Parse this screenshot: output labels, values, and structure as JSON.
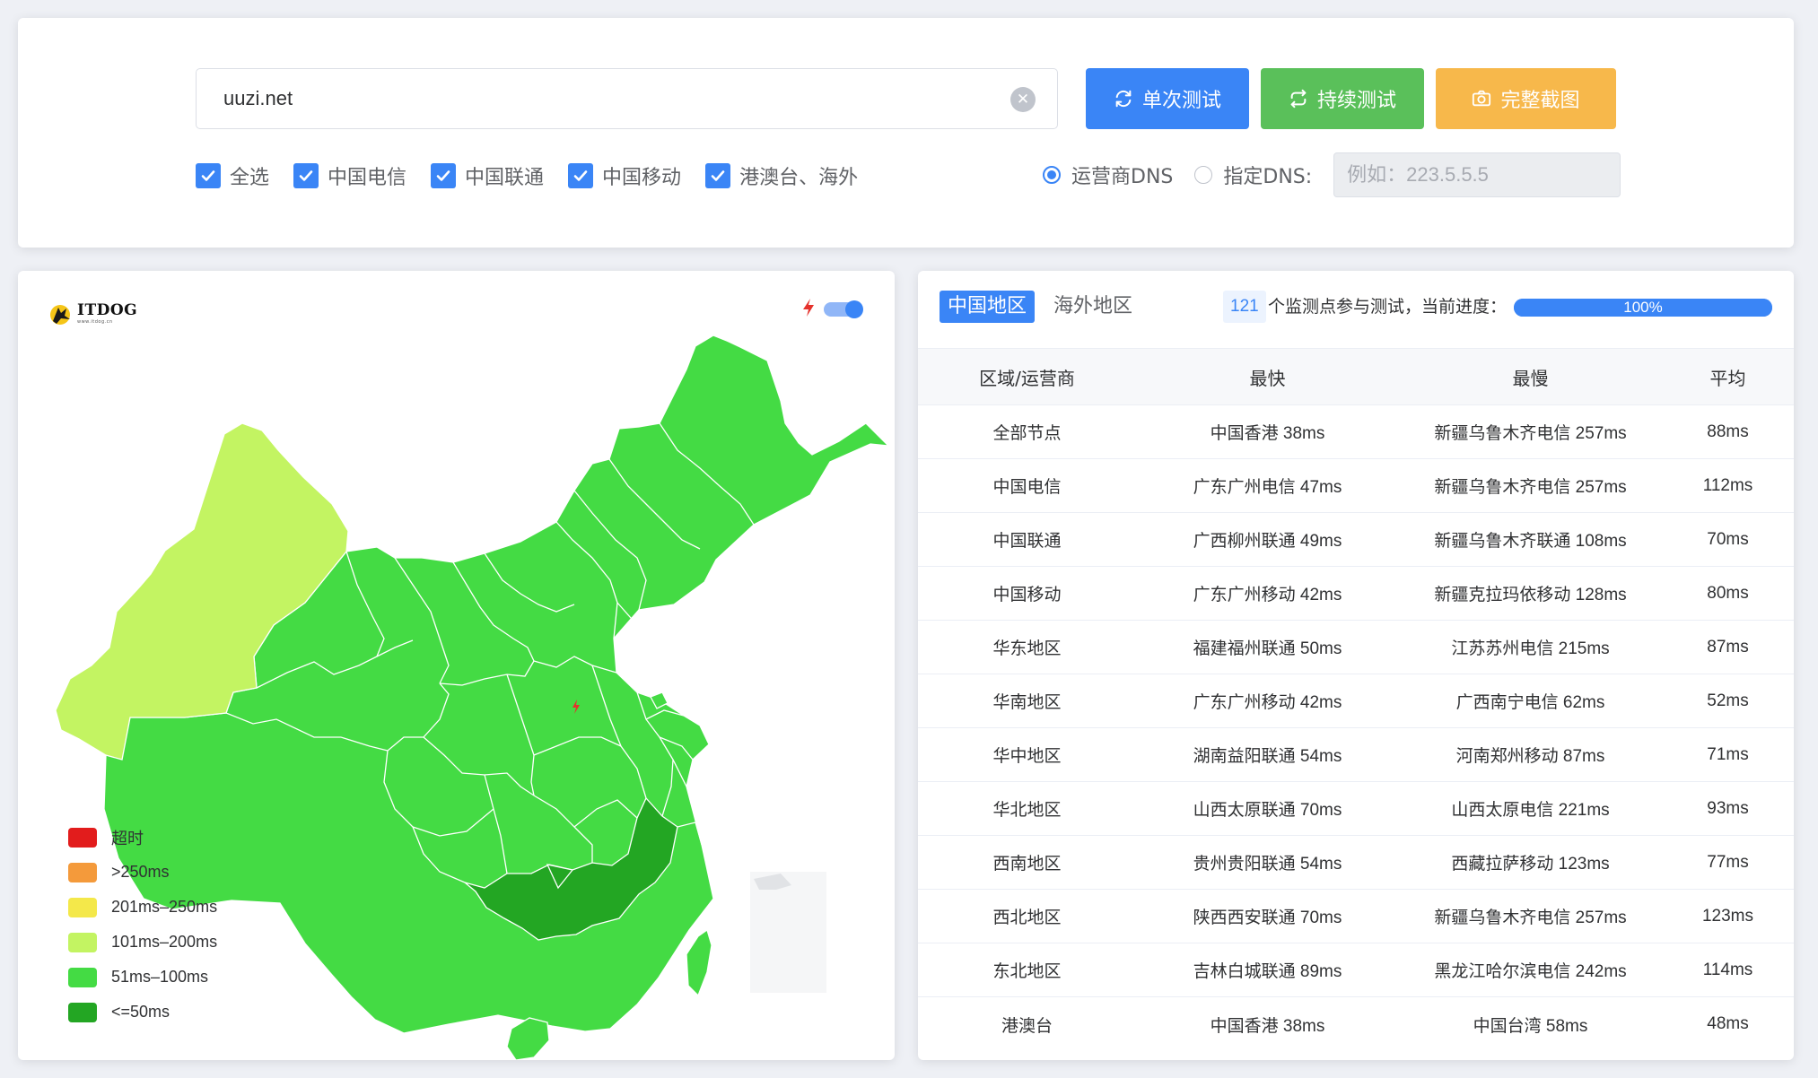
{
  "search": {
    "url_value": "uuzi.net",
    "clear_icon": "close-circle-icon"
  },
  "buttons": {
    "single_test": "单次测试",
    "continuous_test": "持续测试",
    "full_screenshot": "完整截图"
  },
  "carriers": [
    {
      "label": "全选",
      "checked": true
    },
    {
      "label": "中国电信",
      "checked": true
    },
    {
      "label": "中国联通",
      "checked": true
    },
    {
      "label": "中国移动",
      "checked": true
    },
    {
      "label": "港澳台、海外",
      "checked": true
    }
  ],
  "dns": {
    "carrier_dns_label": "运营商DNS",
    "custom_dns_label": "指定DNS:",
    "custom_dns_placeholder": "例如：223.5.5.5",
    "selected": "carrier"
  },
  "map_panel": {
    "logo_text": "ITDOG",
    "logo_sub": "www.itdog.cn",
    "legend": [
      {
        "label": "超时",
        "color": "#e21c1c"
      },
      {
        "label": ">250ms",
        "color": "#f49a3b"
      },
      {
        "label": "201ms–250ms",
        "color": "#f4e84a"
      },
      {
        "label": "101ms–200ms",
        "color": "#c3f462"
      },
      {
        "label": "51ms–100ms",
        "color": "#44db44"
      },
      {
        "label": "<=50ms",
        "color": "#23a623"
      }
    ]
  },
  "results": {
    "tabs": [
      {
        "label": "中国地区",
        "active": true
      },
      {
        "label": "海外地区",
        "active": false
      }
    ],
    "node_count": "121",
    "count_text": "个监测点参与测试，当前进度：",
    "progress_percent": 100,
    "progress_label": "100%",
    "columns": [
      "区域/运营商",
      "最快",
      "最慢",
      "平均"
    ],
    "rows": [
      [
        "全部节点",
        "中国香港 38ms",
        "新疆乌鲁木齐电信 257ms",
        "88ms"
      ],
      [
        "中国电信",
        "广东广州电信 47ms",
        "新疆乌鲁木齐电信 257ms",
        "112ms"
      ],
      [
        "中国联通",
        "广西柳州联通 49ms",
        "新疆乌鲁木齐联通 108ms",
        "70ms"
      ],
      [
        "中国移动",
        "广东广州移动 42ms",
        "新疆克拉玛依移动 128ms",
        "80ms"
      ],
      [
        "华东地区",
        "福建福州联通 50ms",
        "江苏苏州电信 215ms",
        "87ms"
      ],
      [
        "华南地区",
        "广东广州移动 42ms",
        "广西南宁电信 62ms",
        "52ms"
      ],
      [
        "华中地区",
        "湖南益阳联通 54ms",
        "河南郑州移动 87ms",
        "71ms"
      ],
      [
        "华北地区",
        "山西太原联通 70ms",
        "山西太原电信 221ms",
        "93ms"
      ],
      [
        "西南地区",
        "贵州贵阳联通 54ms",
        "西藏拉萨移动 123ms",
        "77ms"
      ],
      [
        "西北地区",
        "陕西西安联通 70ms",
        "新疆乌鲁木齐电信 257ms",
        "123ms"
      ],
      [
        "东北地区",
        "吉林白城联通 89ms",
        "黑龙江哈尔滨电信 242ms",
        "114ms"
      ],
      [
        "港澳台",
        "中国香港 38ms",
        "中国台湾 58ms",
        "48ms"
      ]
    ]
  }
}
